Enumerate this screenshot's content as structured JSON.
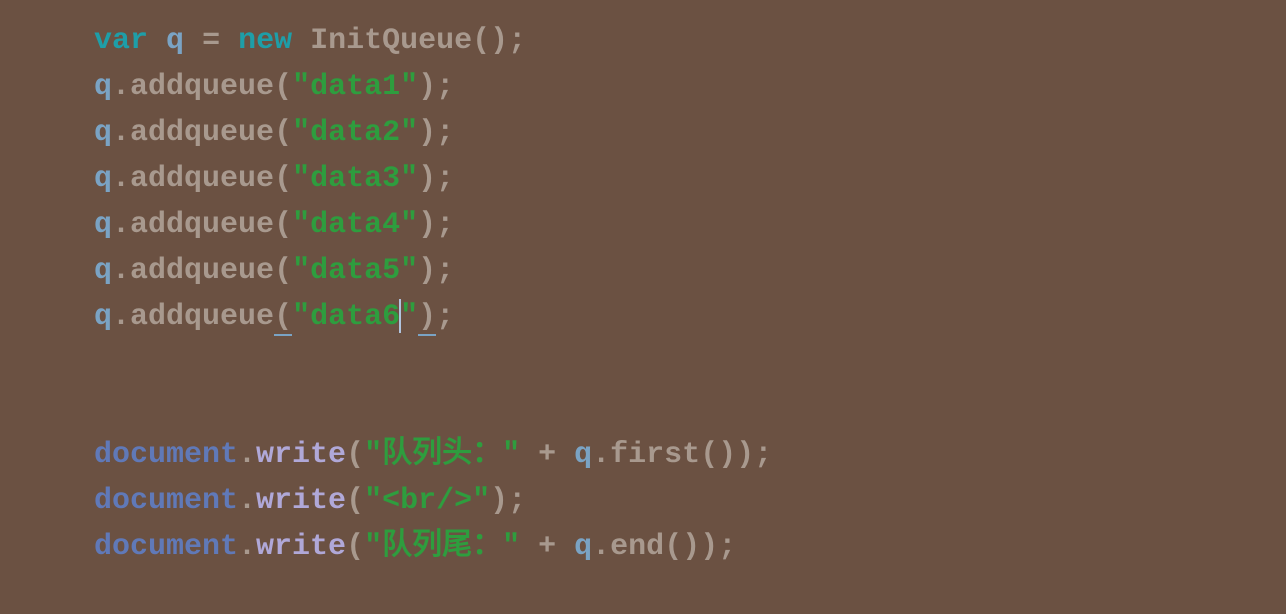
{
  "code": {
    "line1": {
      "kw_var": "var",
      "sp1": " ",
      "var_q": "q",
      "sp2": " ",
      "eq": "=",
      "sp3": " ",
      "kw_new": "new",
      "sp4": " ",
      "ctor": "InitQueue",
      "parens": "()",
      "semi": ";"
    },
    "addq": [
      {
        "obj": "q",
        "dot": ".",
        "method": "addqueue",
        "open": "(",
        "str": "\"data1\"",
        "close": ")",
        "semi": ";"
      },
      {
        "obj": "q",
        "dot": ".",
        "method": "addqueue",
        "open": "(",
        "str": "\"data2\"",
        "close": ")",
        "semi": ";"
      },
      {
        "obj": "q",
        "dot": ".",
        "method": "addqueue",
        "open": "(",
        "str": "\"data3\"",
        "close": ")",
        "semi": ";"
      },
      {
        "obj": "q",
        "dot": ".",
        "method": "addqueue",
        "open": "(",
        "str": "\"data4\"",
        "close": ")",
        "semi": ";"
      },
      {
        "obj": "q",
        "dot": ".",
        "method": "addqueue",
        "open": "(",
        "str": "\"data5\"",
        "close": ")",
        "semi": ";"
      },
      {
        "obj": "q",
        "dot": ".",
        "method": "addqueue",
        "open": "(",
        "str_a": "\"data6",
        "str_b": "\"",
        "close": ")",
        "semi": ";"
      }
    ],
    "docw": [
      {
        "doc": "document",
        "dot": ".",
        "write": "write",
        "open": "(",
        "str": "\"队列头：\"",
        "sp1": " ",
        "plus": "+",
        "sp2": " ",
        "obj": "q",
        "dot2": ".",
        "method": "first",
        "parens": "()",
        "close": ")",
        "semi": ";"
      },
      {
        "doc": "document",
        "dot": ".",
        "write": "write",
        "open": "(",
        "str": "\"<br/>\"",
        "close": ")",
        "semi": ";"
      },
      {
        "doc": "document",
        "dot": ".",
        "write": "write",
        "open": "(",
        "str": "\"队列尾：\"",
        "sp1": " ",
        "plus": "+",
        "sp2": " ",
        "obj": "q",
        "dot2": ".",
        "method": "end",
        "parens": "()",
        "close": ")",
        "semi": ";"
      }
    ]
  }
}
